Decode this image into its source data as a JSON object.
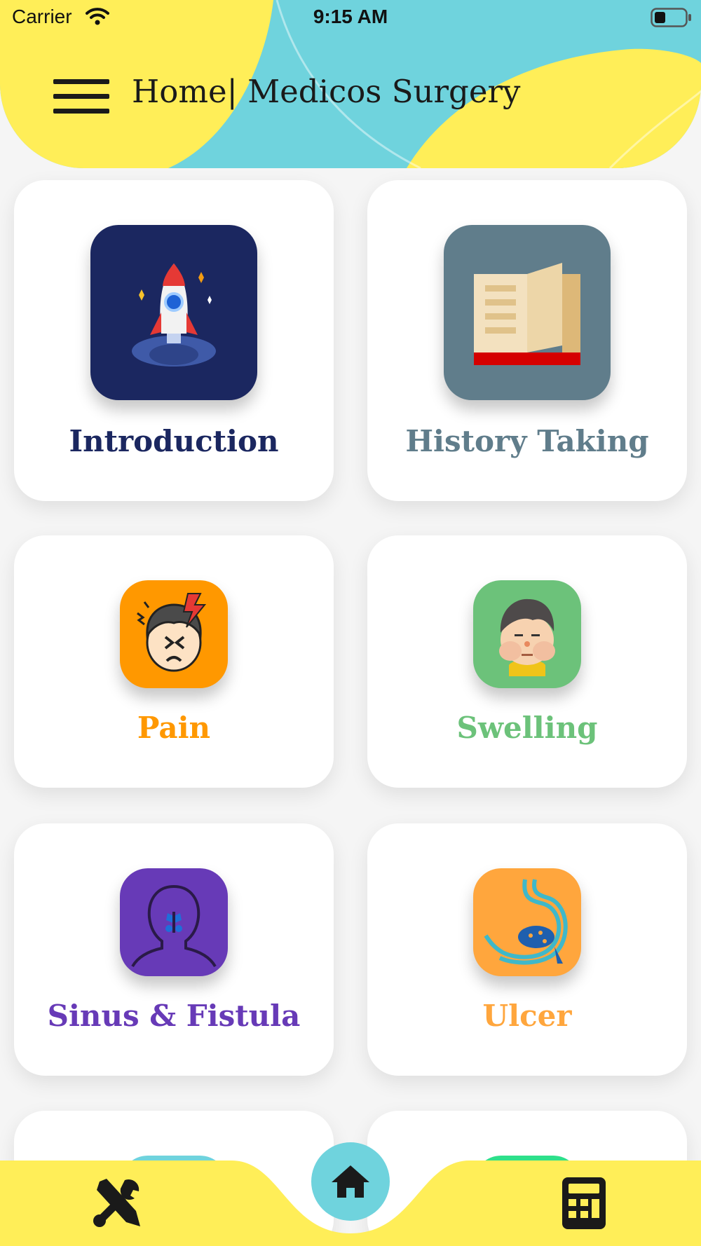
{
  "status_bar": {
    "carrier": "Carrier",
    "time": "9:15 AM"
  },
  "header": {
    "title": "Home| Medicos Surgery",
    "menu_icon": "hamburger-menu-icon"
  },
  "cards": [
    {
      "label": "Introduction",
      "icon": "rocket-icon",
      "tile_color": "#1b2760",
      "label_color": "#1b2760"
    },
    {
      "label": "History Taking",
      "icon": "open-book-icon",
      "tile_color": "#607d8b",
      "label_color": "#607d8b"
    },
    {
      "label": "Pain",
      "icon": "headache-face-icon",
      "tile_color": "#ff9800",
      "label_color": "#ff9800"
    },
    {
      "label": "Swelling",
      "icon": "swollen-face-icon",
      "tile_color": "#6cc27a",
      "label_color": "#6cc27a"
    },
    {
      "label": "Sinus & Fistula",
      "icon": "sinus-head-icon",
      "tile_color": "#673ab7",
      "label_color": "#673ab7"
    },
    {
      "label": "Ulcer",
      "icon": "stomach-icon",
      "tile_color": "#ffa63d",
      "label_color": "#ffa63d"
    }
  ],
  "bottom_nav": {
    "left_icon": "tools-icon",
    "center_icon": "home-icon",
    "right_icon": "calculator-icon"
  },
  "colors": {
    "yellow": "#ffee58",
    "cyan": "#6fd3dd",
    "background": "#f5f5f5"
  }
}
